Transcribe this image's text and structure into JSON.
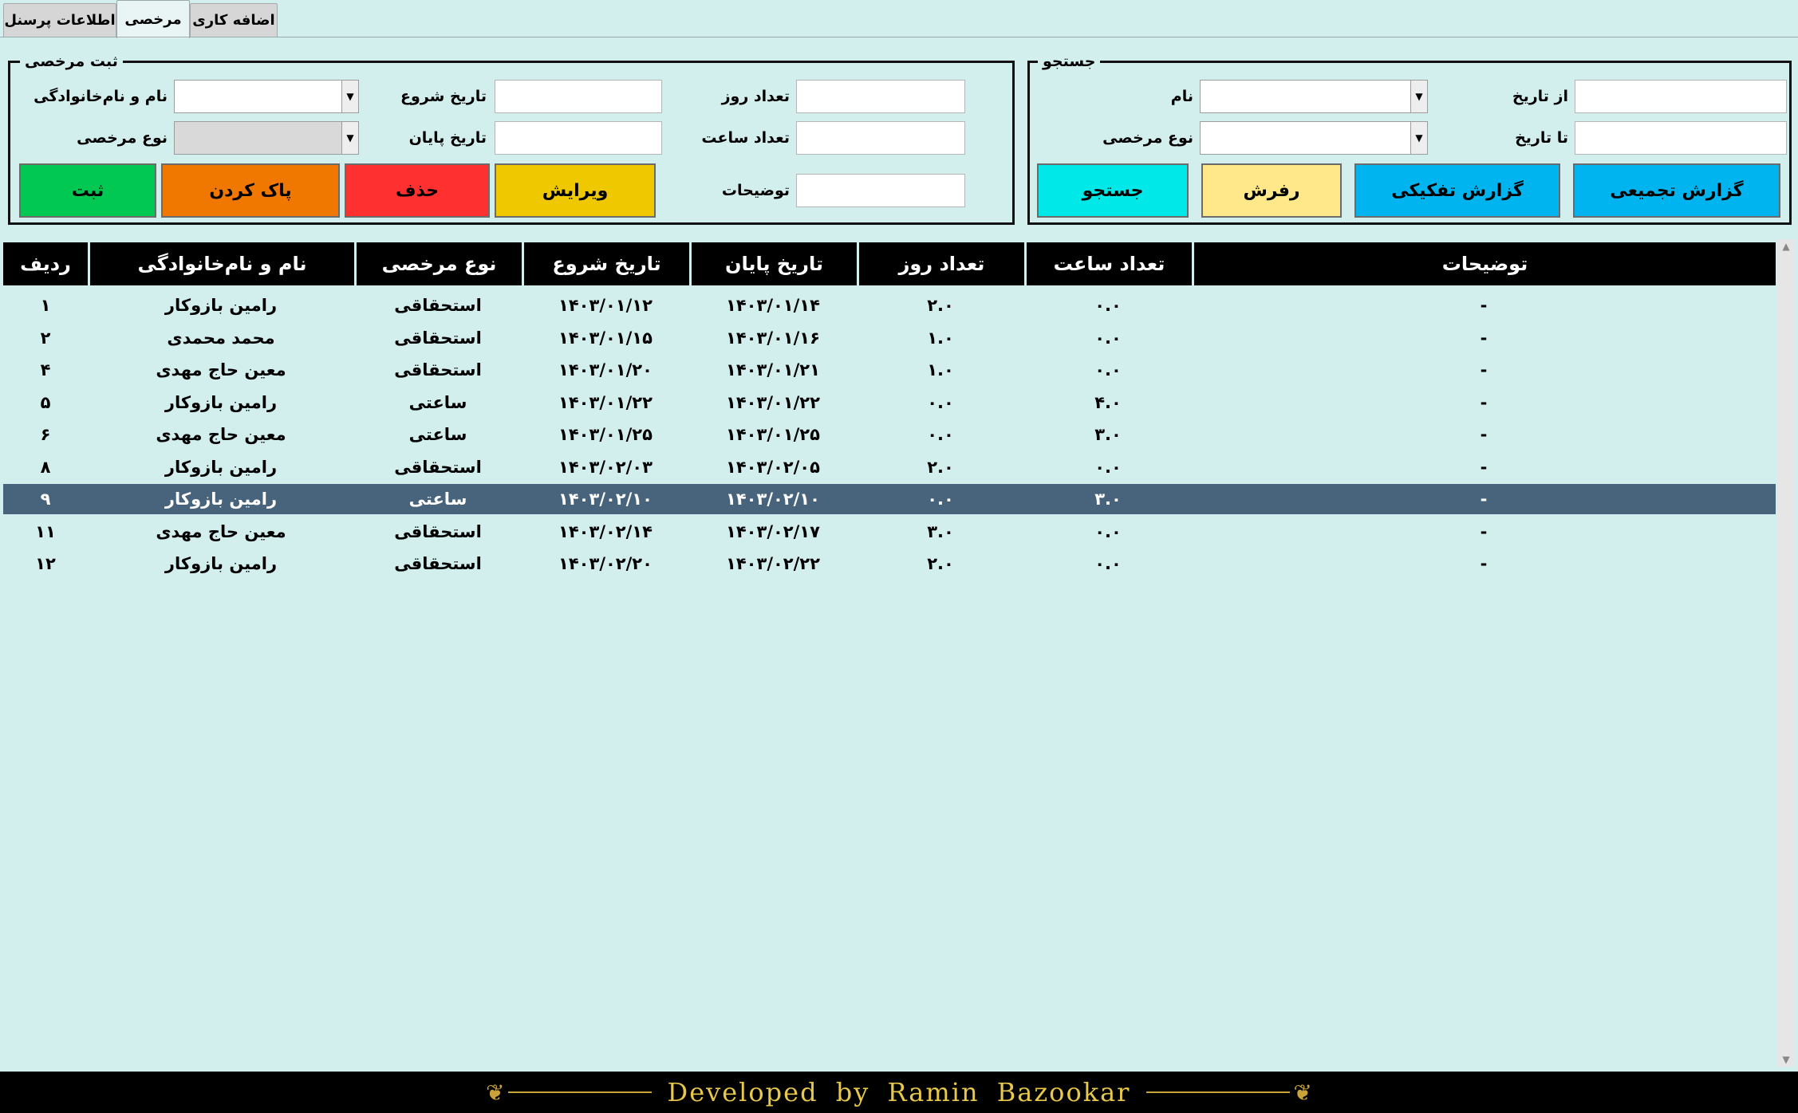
{
  "tabs": {
    "personnel": "اطلاعات پرسنل",
    "leave": "مرخصی",
    "overtime": "اضافه کاری"
  },
  "register": {
    "legend": "ثبت مرخصی",
    "name_label": "نام و نام‌خانوادگی",
    "start_label": "تاریخ شروع",
    "days_label": "تعداد روز",
    "type_label": "نوع مرخصی",
    "end_label": "تاریخ پایان",
    "hours_label": "تعداد ساعت",
    "desc_label": "توضیحات",
    "btn_save": "ثبت",
    "btn_clear": "پاک کردن",
    "btn_delete": "حذف",
    "btn_edit": "ویرایش"
  },
  "search": {
    "legend": "جستجو",
    "name_label": "نام",
    "from_label": "از تاریخ",
    "type_label": "نوع مرخصی",
    "to_label": "تا تاریخ",
    "btn_search": "جستجو",
    "btn_refresh": "رفرش",
    "btn_detail": "گزارش تفکیکی",
    "btn_summary": "گزارش تجمیعی"
  },
  "colors": {
    "save": "#00c853",
    "clear": "#f07800",
    "delete": "#ff3030",
    "edit": "#f0c800",
    "search": "#00e8e8",
    "refresh": "#ffe88a",
    "report": "#00b4f0",
    "selected_row": "#48647d"
  },
  "table": {
    "headers": [
      "ردیف",
      "نام و نام‌خانوادگی",
      "نوع مرخصی",
      "تاریخ شروع",
      "تاریخ پایان",
      "تعداد روز",
      "تعداد ساعت",
      "توضیحات"
    ],
    "rows": [
      [
        "۱",
        "رامین بازوکار",
        "استحقاقی",
        "۱۴۰۳/۰۱/۱۲",
        "۱۴۰۳/۰۱/۱۴",
        "۲.۰",
        "۰.۰",
        "-"
      ],
      [
        "۲",
        "محمد محمدی",
        "استحقاقی",
        "۱۴۰۳/۰۱/۱۵",
        "۱۴۰۳/۰۱/۱۶",
        "۱.۰",
        "۰.۰",
        "-"
      ],
      [
        "۴",
        "معین حاج مهدی",
        "استحقاقی",
        "۱۴۰۳/۰۱/۲۰",
        "۱۴۰۳/۰۱/۲۱",
        "۱.۰",
        "۰.۰",
        "-"
      ],
      [
        "۵",
        "رامین بازوکار",
        "ساعتی",
        "۱۴۰۳/۰۱/۲۲",
        "۱۴۰۳/۰۱/۲۲",
        "۰.۰",
        "۴.۰",
        "-"
      ],
      [
        "۶",
        "معین حاج مهدی",
        "ساعتی",
        "۱۴۰۳/۰۱/۲۵",
        "۱۴۰۳/۰۱/۲۵",
        "۰.۰",
        "۳.۰",
        "-"
      ],
      [
        "۸",
        "رامین بازوکار",
        "استحقاقی",
        "۱۴۰۳/۰۲/۰۳",
        "۱۴۰۳/۰۲/۰۵",
        "۲.۰",
        "۰.۰",
        "-"
      ],
      [
        "۹",
        "رامین بازوکار",
        "ساعتی",
        "۱۴۰۳/۰۲/۱۰",
        "۱۴۰۳/۰۲/۱۰",
        "۰.۰",
        "۳.۰",
        "-"
      ],
      [
        "۱۱",
        "معین حاج مهدی",
        "استحقاقی",
        "۱۴۰۳/۰۲/۱۴",
        "۱۴۰۳/۰۲/۱۷",
        "۳.۰",
        "۰.۰",
        "-"
      ],
      [
        "۱۲",
        "رامین بازوکار",
        "استحقاقی",
        "۱۴۰۳/۰۲/۲۰",
        "۱۴۰۳/۰۲/۲۲",
        "۲.۰",
        "۰.۰",
        "-"
      ]
    ],
    "selected_row_index": 6
  },
  "footer": {
    "text": "Developed by Ramin Bazookar"
  }
}
